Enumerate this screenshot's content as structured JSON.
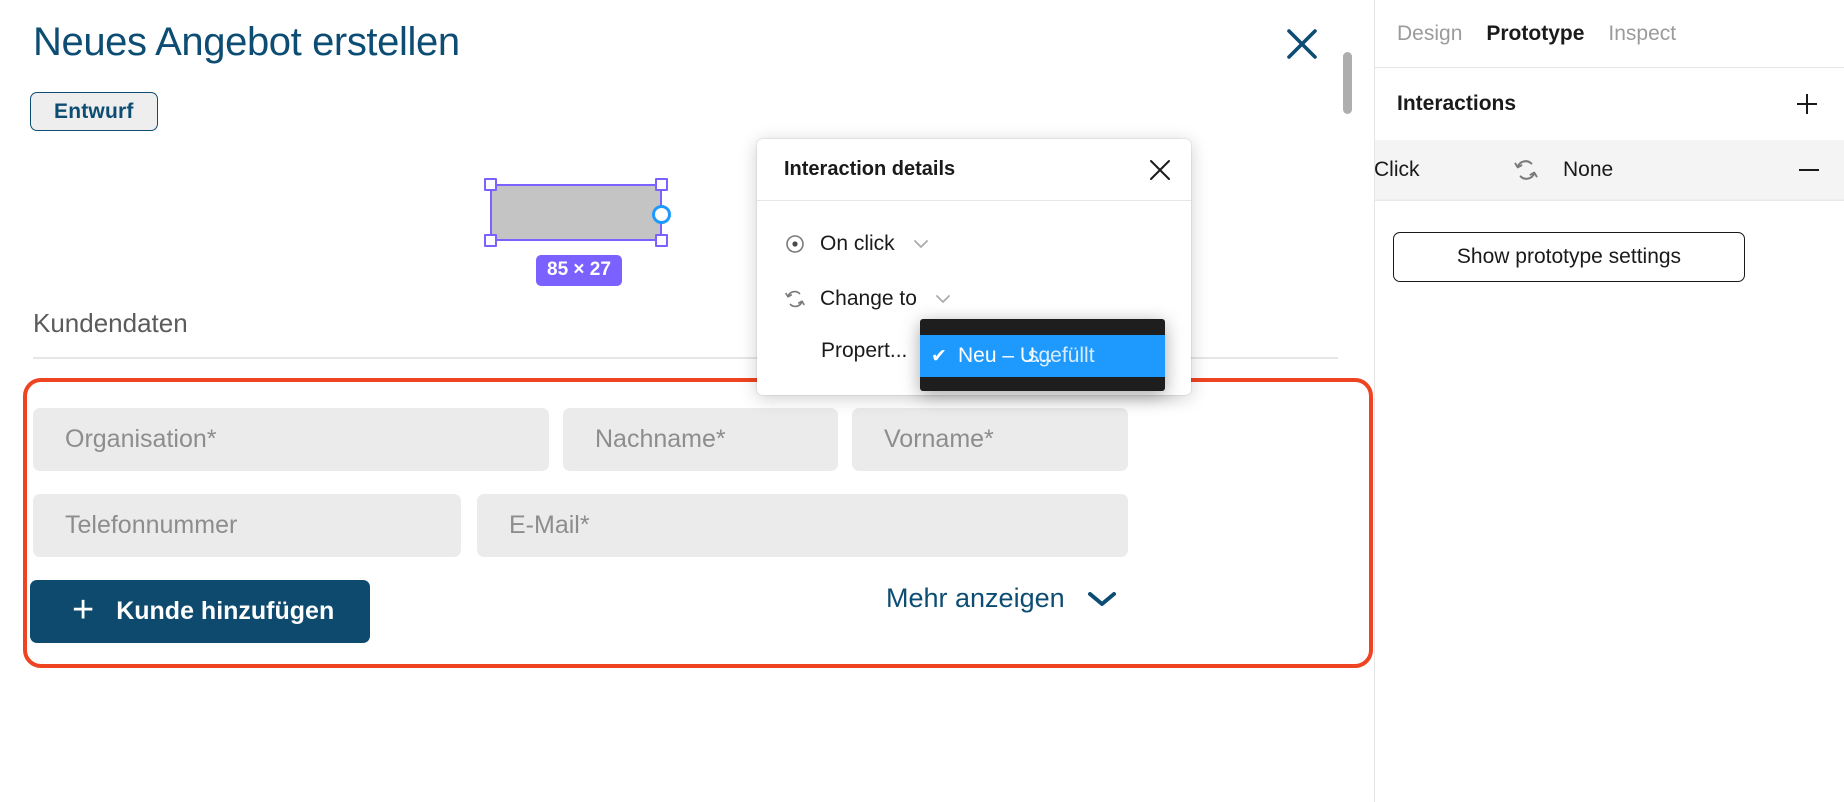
{
  "modal": {
    "title": "Neues Angebot erstellen",
    "close_icon": "close-icon",
    "status_badge": "Entwurf",
    "section_title": "Kundendaten",
    "selection": {
      "size_label": "85 × 27",
      "accent_color": "#7b61ff",
      "connector_color": "#1e9afe"
    },
    "fields": [
      {
        "placeholder": "Organisation*",
        "value": ""
      },
      {
        "placeholder": "Nachname*",
        "value": ""
      },
      {
        "placeholder": "Vorname*",
        "value": ""
      },
      {
        "placeholder": "Telefonnummer",
        "value": ""
      },
      {
        "placeholder": "E-Mail*",
        "value": ""
      }
    ],
    "add_customer_button": {
      "plus": "+",
      "label": "Kunde hinzufügen"
    },
    "more_link": {
      "label": "Mehr anzeigen",
      "icon": "chevron-down-icon"
    },
    "annotation_color": "#ee4422",
    "brand_color": "#0d4d73"
  },
  "interaction_popup": {
    "title": "Interaction details",
    "close_icon": "close-icon",
    "rows": [
      {
        "icon": "target-icon",
        "label": "On click",
        "chevron": "chevron-down-icon"
      },
      {
        "icon": "change-to-icon",
        "label": "Change to",
        "chevron": "chevron-down-icon"
      },
      {
        "icon": "",
        "label": "Propert...",
        "chevron": ""
      }
    ]
  },
  "value_dropdown": {
    "checkmark": "✔",
    "selected_label": "Neu – U...",
    "ghost_label": "sgefüllt",
    "highlight_color": "#1e9afe",
    "background_color": "#1e1e1e"
  },
  "right_panel": {
    "tabs": [
      {
        "label": "Design",
        "active": false
      },
      {
        "label": "Prototype",
        "active": true
      },
      {
        "label": "Inspect",
        "active": false
      }
    ],
    "interactions": {
      "title": "Interactions",
      "add_icon": "plus-icon",
      "rows": [
        {
          "trigger": "Click",
          "action_icon": "change-to-icon",
          "action": "None",
          "remove_icon": "minus-icon"
        }
      ]
    },
    "prototype_settings_button": "Show prototype settings"
  }
}
